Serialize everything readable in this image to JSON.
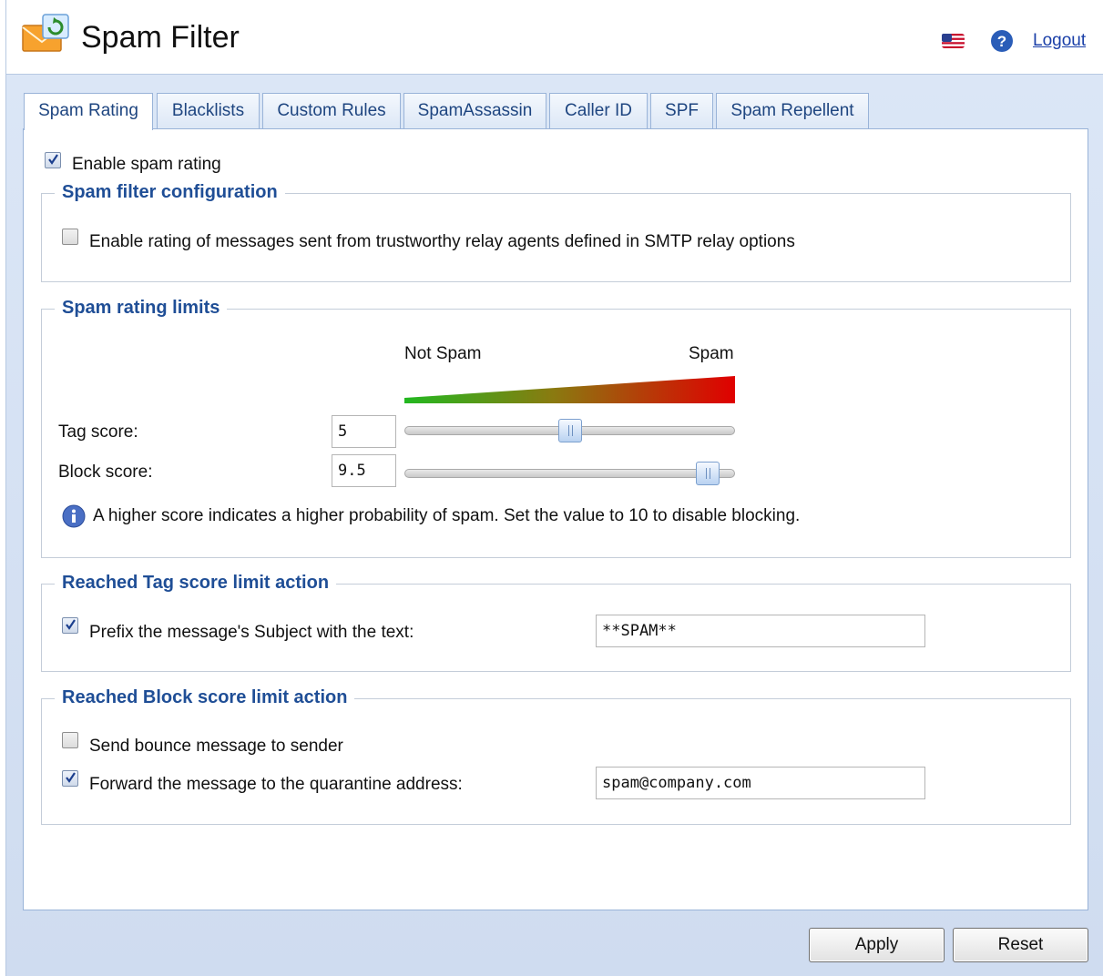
{
  "header": {
    "title": "Spam Filter",
    "logout_label": "Logout"
  },
  "tabs": [
    {
      "label": "Spam Rating",
      "active": true
    },
    {
      "label": "Blacklists",
      "active": false
    },
    {
      "label": "Custom Rules",
      "active": false
    },
    {
      "label": "SpamAssassin",
      "active": false
    },
    {
      "label": "Caller ID",
      "active": false
    },
    {
      "label": "SPF",
      "active": false
    },
    {
      "label": "Spam Repellent",
      "active": false
    }
  ],
  "enable_spam_rating": {
    "label": "Enable spam rating",
    "checked": true
  },
  "config": {
    "legend": "Spam filter configuration",
    "trustworthy": {
      "label": "Enable rating of messages sent from trustworthy relay agents defined in SMTP relay options",
      "checked": false
    }
  },
  "limits": {
    "legend": "Spam rating limits",
    "not_spam_label": "Not Spam",
    "spam_label": "Spam",
    "gradient_colors": [
      "#22b820",
      "#e00000"
    ],
    "tag_score_label": "Tag score:",
    "tag_score_value": "5",
    "block_score_label": "Block score:",
    "block_score_value": "9.5",
    "slider_max": 10,
    "info_text": "A higher score indicates a higher probability of spam. Set the value to 10 to disable blocking."
  },
  "tag_action": {
    "legend": "Reached Tag score limit action",
    "prefix": {
      "label": "Prefix the message's Subject with the text:",
      "checked": true
    },
    "prefix_value": "**SPAM**"
  },
  "block_action": {
    "legend": "Reached Block score limit action",
    "bounce": {
      "label": "Send bounce message to sender",
      "checked": false
    },
    "forward": {
      "label": "Forward the message to the quarantine address:",
      "checked": true
    },
    "forward_value": "spam@company.com"
  },
  "buttons": {
    "apply": "Apply",
    "reset": "Reset"
  },
  "colors": {
    "accent": "#1f4e96",
    "link": "#1a3fa8",
    "background": "#d5e1f3"
  }
}
